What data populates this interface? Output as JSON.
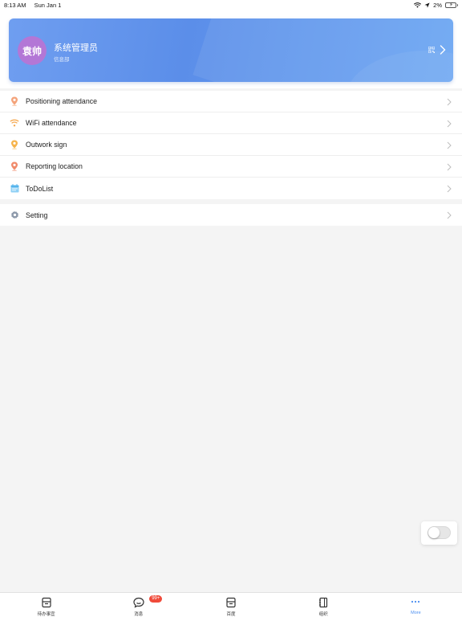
{
  "status_bar": {
    "time": "8:13 AM",
    "date": "Sun Jan 1",
    "battery": "2%"
  },
  "profile": {
    "avatar_text": "袁帅",
    "name": "系统管理员",
    "department": "信息部",
    "avatar_color": "#b377d6"
  },
  "menu": {
    "items": [
      {
        "label": "Positioning attendance",
        "icon": "location-pin-icon"
      },
      {
        "label": "WiFi attendance",
        "icon": "wifi-icon"
      },
      {
        "label": "Outwork sign",
        "icon": "location-pin-icon"
      },
      {
        "label": "Reporting location",
        "icon": "location-pin-icon"
      },
      {
        "label": "ToDoList",
        "icon": "calendar-icon"
      }
    ],
    "settings": {
      "label": "Setting",
      "icon": "gear-icon"
    }
  },
  "tabbar": {
    "tabs": [
      {
        "label": "待办事宜",
        "icon": "inbox-icon"
      },
      {
        "label": "消息",
        "icon": "chat-bubble-icon",
        "badge": "99+"
      },
      {
        "label": "百度",
        "icon": "inbox-icon"
      },
      {
        "label": "组织",
        "icon": "address-book-icon"
      },
      {
        "label": "More",
        "icon": "more-dots-icon",
        "active": true
      }
    ]
  },
  "colors": {
    "accent": "#4a8ef0",
    "badge": "#f04a3a",
    "card_gradient_start": "#6f9ef0",
    "card_gradient_end": "#6aa5f2"
  }
}
